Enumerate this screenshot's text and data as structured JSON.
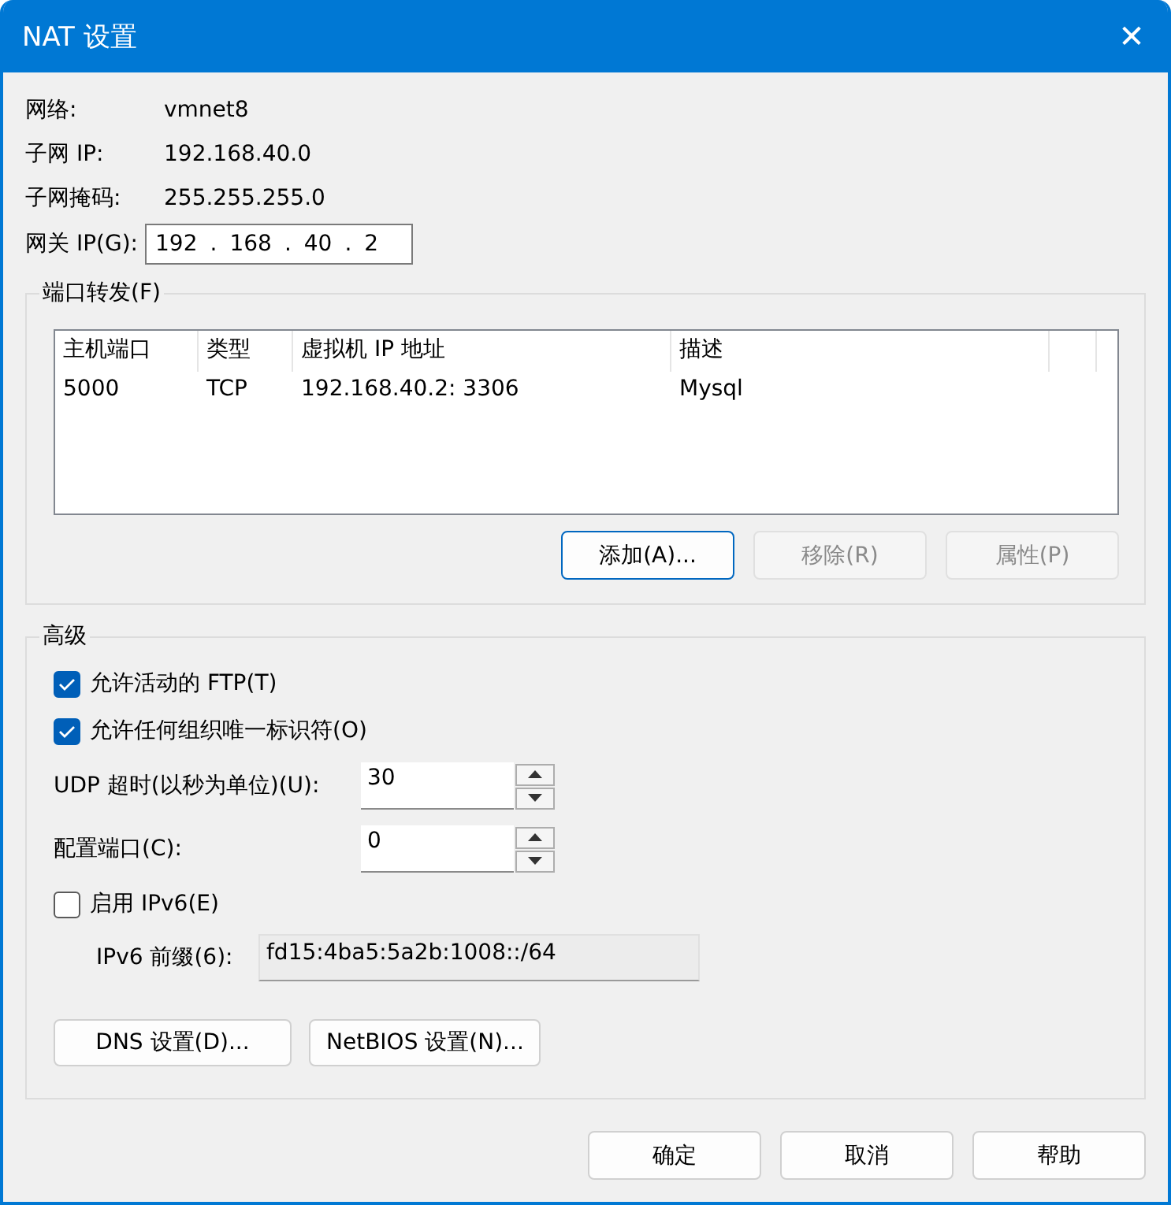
{
  "window": {
    "title": "NAT 设置",
    "close": "✕"
  },
  "info": [
    {
      "label": "网络:",
      "value": "vmnet8"
    },
    {
      "label": "子网 IP:",
      "value": "192.168.40.0"
    },
    {
      "label": "子网掩码:",
      "value": "255.255.255.0"
    }
  ],
  "gateway": {
    "label": "网关 IP(G):",
    "octets": [
      "192",
      "168",
      "40",
      "2"
    ],
    "separator": "."
  },
  "port_forwarding": {
    "title": "端口转发(F)",
    "table": {
      "columns": [
        "主机端口",
        "类型",
        "虚拟机 IP 地址",
        "描述"
      ],
      "rows": [
        [
          "5000",
          "TCP",
          "192.168.40.2: 3306",
          "Mysql"
        ]
      ]
    },
    "buttons": [
      {
        "label": "添加(A)...",
        "disabled": false,
        "focused": true
      },
      {
        "label": "移除(R)",
        "disabled": true,
        "focused": false
      },
      {
        "label": "属性(P)",
        "disabled": true,
        "focused": false
      }
    ]
  },
  "advanced": {
    "title": "高级",
    "checkboxes": [
      {
        "label": "允许活动的 FTP(T)",
        "checked": true
      },
      {
        "label": "允许任何组织唯一标识符(O)",
        "checked": true
      }
    ],
    "spinners": [
      {
        "label": "UDP 超时(以秒为单位)(U):",
        "value": "30"
      },
      {
        "label": "配置端口(C):",
        "value": "0"
      }
    ],
    "ipv6": {
      "label": "启用 IPv6(E)",
      "checked": false,
      "prefix_label": "IPv6 前缀(6):",
      "prefix_value": "fd15:4ba5:5a2b:1008::/64"
    },
    "buttons": [
      "DNS 设置(D)...",
      "NetBIOS 设置(N)..."
    ]
  },
  "footer_buttons": [
    "确定",
    "取消",
    "帮助"
  ]
}
